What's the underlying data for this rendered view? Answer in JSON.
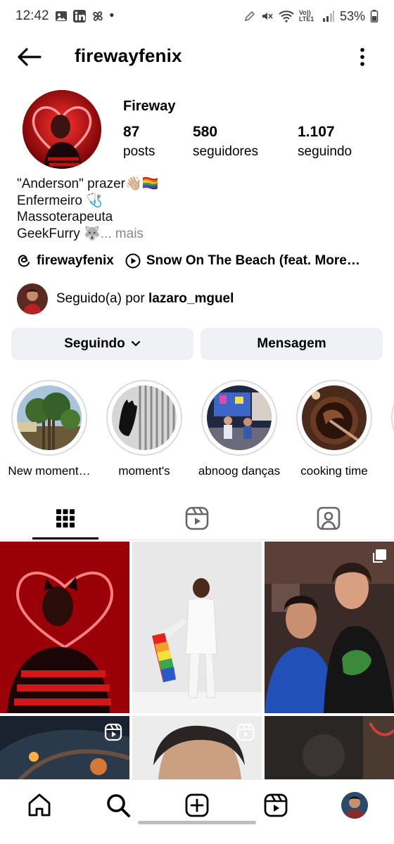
{
  "status_bar": {
    "time": "12:42",
    "dot": "•",
    "battery": "53%",
    "network_label": "Vo)) LTE1",
    "icons": [
      "image-icon",
      "linkedin-icon",
      "pinwheel-icon",
      "pencil-icon",
      "mute-icon",
      "wifi-icon",
      "signal-icon",
      "battery-icon"
    ]
  },
  "header": {
    "username": "firewayfenix",
    "back_icon": "back-arrow-icon",
    "more_icon": "more-vertical-icon"
  },
  "profile": {
    "display_name": "Fireway",
    "stats": [
      {
        "value": "87",
        "label": "posts"
      },
      {
        "value": "580",
        "label": "seguidores"
      },
      {
        "value": "1.107",
        "label": "seguindo"
      }
    ],
    "bio_lines": [
      "\"Anderson\"  prazer👋🏼🏳️‍🌈",
      "Enfermeiro 🩺",
      "Massoterapeuta",
      "GeekFurry 🐺"
    ],
    "bio_more": "... mais",
    "threads_handle": "firewayfenix",
    "music": "Snow On The Beach (feat. More…",
    "followed_by_prefix": "Seguido(a) por ",
    "followed_by_user": "lazaro_mguel"
  },
  "actions": {
    "following_label": "Seguindo",
    "message_label": "Mensagem"
  },
  "highlights": [
    {
      "label": "New moment…"
    },
    {
      "label": "moment's"
    },
    {
      "label": "abnoog danças"
    },
    {
      "label": "cooking time"
    }
  ],
  "tabs": [
    "grid-icon",
    "reels-icon",
    "tagged-icon"
  ],
  "bottom_nav": [
    "home-icon",
    "search-icon",
    "create-icon",
    "reels-icon",
    "profile-avatar"
  ],
  "colors": {
    "button_bg": "#eff1f4",
    "ring": "#dcdcdc",
    "muted_text": "#888888",
    "neon_red": "#e8162a"
  }
}
